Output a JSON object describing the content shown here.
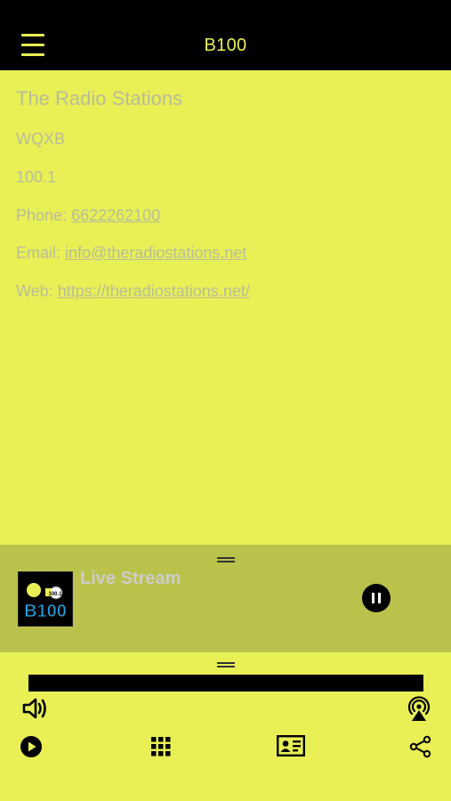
{
  "header": {
    "title": "B100",
    "menu_icon": "menu-icon"
  },
  "info": {
    "title": "The Radio Stations",
    "callsign": "WQXB",
    "frequency": "100.1",
    "phone_label": "Phone:",
    "phone": "6622262100",
    "email_label": "Email:",
    "email": "info@theradiostations.net",
    "web_label": "Web:",
    "web": "https://theradiostations.net/"
  },
  "player": {
    "stream_title": "Live Stream",
    "logo_text": "B100",
    "logo_badge": "100.1",
    "state": "playing"
  },
  "toolbar": {
    "icons": [
      "volume-icon",
      "airplay-icon",
      "play-icon",
      "grid-icon",
      "contact-card-icon",
      "share-icon"
    ]
  },
  "colors": {
    "background": "#e9f055",
    "header_bg": "#000000",
    "accent": "#e9f055",
    "panel": "#bbc24b",
    "text_muted": "#b9bc9a"
  }
}
